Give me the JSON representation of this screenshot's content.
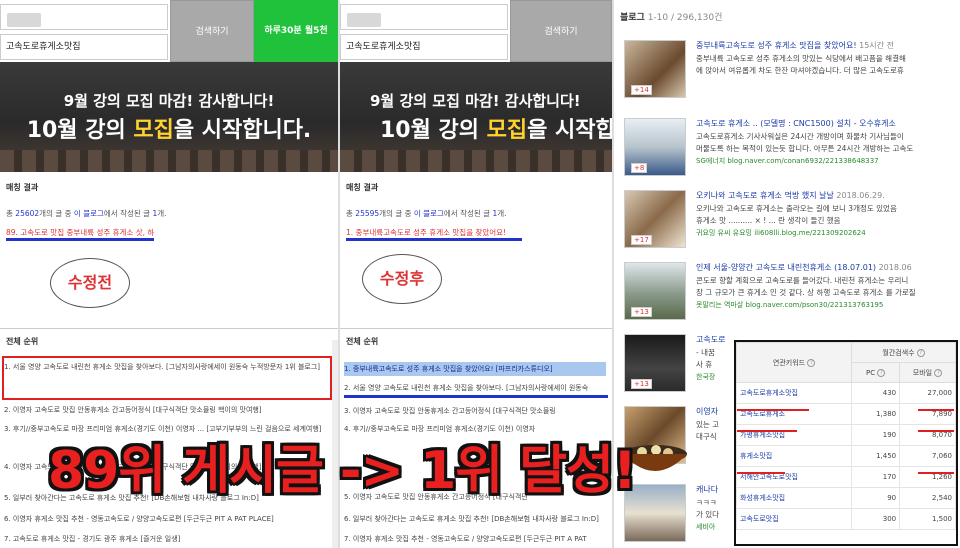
{
  "left": {
    "search_value": "고속도로휴게소맛집",
    "search_btn": "검색하기",
    "green_btn": "하루30분 월5천",
    "banner1": "9월 강의 모집 마감! 감사합니다!",
    "banner2_pre": "10월 강의 ",
    "banner2_y": "모집",
    "banner2_post": "을 시작합니다.",
    "section_match": "매칭 결과",
    "count_line_a": "총 ",
    "count_num": "25602",
    "count_line_b": "개의 글 중 ",
    "count_blog": "이 블로그",
    "count_line_c": "에서 작성된 글 ",
    "count_one": "1",
    "count_line_d": "개.",
    "match_line": "89. 고속도로 맛집 중부내륙 성주 휴게소 삿, 하",
    "bubble": "수정전",
    "section_rank": "전체 순위",
    "rows": [
      "1. 서울 영양 고속도로 내린천 휴게소 맛집을 찾아보다. [그남자의사랑에세이 원동숙 누적방문자 1위 블로그]",
      "2. 이영자 고속도로 맛집 안동휴게소 간고등어정식 [대구식객단 맛소믈링 핵이의 맛여행]",
      "3. 후기//중부고속도로 마장 프리미엄 휴게소(경기도 이천) 이영자 ... [고부기부부의 느린 걸음으로 세계여행]",
      "4. 이영자 고속도로 맛집 안동휴게소 간고등어정식 [대구식객단 맛소믈링 핵이의 맛여행]",
      "5. 일부러 찾아간다는 고속도로 휴게소 맛집 추천! [DB손해보험 내차사랑 블로그 In:D]",
      "6. 이영자 휴게소 맛집 추천 - 영동고속도로 / 양양고속도로편 [두근두근 PIT A PAT PLACE]",
      "7. 고속도로 휴게소 맛집 - 경기도 광주 휴게소 [즐거운 일생]"
    ]
  },
  "middle": {
    "search_value": "고속도로휴게소맛집",
    "search_btn": "검색하기",
    "banner1": "9월 강의 모집 마감! 감사합니다!",
    "banner2_pre": "10월 강의 ",
    "banner2_y": "모집",
    "banner2_post": "을 시작합니다.",
    "section_match": "매칭 결과",
    "count_line_a": "총 ",
    "count_num": "25595",
    "count_line_b": "개의 글 중 ",
    "count_blog": "이 블로그",
    "count_line_c": "에서 작성된 글 ",
    "count_one": "1",
    "count_line_d": "개.",
    "match_line": "1. 중부내륙고속도로 성주 휴게소 맛집을 찾았어요!",
    "bubble": "수정후",
    "section_rank": "전체 순위",
    "rows": [
      "1. 중부내륙고속도로 성주 휴게소 맛집을 찾았어요! [파프리카스튜디오]",
      "2. 서울 영양 고속도로 내린천 휴게소 맛집을 찾아보다. [그남자의사랑에세이 원동숙",
      "3. 이영자 고속도로 맛집 안동휴게소 간고등어정식 [대구식객단 맛소믈링",
      "4. 후기//중부고속도로 마장 프리미엄 휴게소(경기도 이천) 이영자",
      "5. 이영자 고속도로 맛집 안동휴게소 간고등어정식 [대구식객단",
      "6. 일부러 찾아간다는 고속도로 휴게소 맛집 추천! [DB손해보험 내차사랑 블로그 In:D]",
      "7. 이영자 휴게소 맛집 추천 - 영동고속도로 / 양양고속도로편 [두근두근 PIT A PAT"
    ]
  },
  "overlay_text": "89위 게시글 -> 1위 달성!",
  "right": {
    "header_title": "블로그",
    "header_range": " 1-10 / 296,130건",
    "items": [
      {
        "title": "중부내륙고속도로 성주 휴게소 맛집을 찾았어요!",
        "date": "15시간 전",
        "d1": "중부내륙 고속도로 성주 휴게소의 맛있는 식당에서 배고픔을 해결해",
        "d2": "에 앉아서 여유롭게 차도 한잔 마셔야겠습니다. 더 많은 고속도로휴",
        "url": "",
        "badge": "14"
      },
      {
        "title": "고속도로 휴게소 .. (모델명 : CNC1500) 설치 - 오수휴게소",
        "date": "",
        "d1": "고속도로휴게소 기사사워실은 24시간 개방이며 화물차 기사님들이",
        "d2": "머물도록 하는 목적이 있는듯 합니다. 아무튼 24시간 개방하는 고속도",
        "url": "SG에너지  blog.naver.com/conan6932/221338648337",
        "badge": "8"
      },
      {
        "title": "오키나와 고속도로 휴게소 먹방 했지 날날",
        "date": "2018.06.29.",
        "d1": "오키나와 고속도로 휴게소는 출라오는 길에 보니 3개정도 있었음",
        "d2": "휴게소 맛 .......... ×  ! ...  란 생각이 들긴 했음",
        "url": "귀요밍 유씨 유요밍  ili608lli.blog.me/221309202624",
        "badge": "17"
      },
      {
        "title": "인제 서울-양양간 고속도로 내린천휴게소 (18.07.01)",
        "date": "2018.06",
        "d1": "콘도로 향할 계획으로 고속도로를 들어갔다. 내린천 휴게소는 우리니",
        "d2": "장 그 규모가 큰 휴게소 인 것 같다. 상 하행 고속도로 휴게소 를 가로질",
        "url": "못말리는 역마살  blog.naver.com/pson30/221313763195",
        "badge": "13"
      },
      {
        "title": "고속도로",
        "date": "",
        "d1": "- 내꿈",
        "d2": "사 휴",
        "url": "한국장",
        "badge": "13"
      },
      {
        "title": "이영자",
        "date": "",
        "d1": "있는 고",
        "d2": "대구식",
        "url": "",
        "badge": "14"
      },
      {
        "title": "캐나다",
        "date": "",
        "d1": "ㅋㅋㅋ",
        "d2": "가 있다",
        "url": "세비아",
        "badge": ""
      }
    ]
  },
  "keyword_table": {
    "h_kw": "연관키워드",
    "h_month": "월간검색수",
    "h_pc": "PC",
    "h_mobile": "모바일",
    "rows": [
      {
        "kw": "고속도로휴게소맛집",
        "pc": "430",
        "mobile": "27,000"
      },
      {
        "kw": "고속도로휴게소",
        "pc": "1,380",
        "mobile": "7,890"
      },
      {
        "kw": "가평휴게소맛집",
        "pc": "190",
        "mobile": "8,070"
      },
      {
        "kw": "휴게소맛집",
        "pc": "1,450",
        "mobile": "7,060"
      },
      {
        "kw": "서해안고속도로맛집",
        "pc": "170",
        "mobile": "1,260"
      },
      {
        "kw": "화성휴게소맛집",
        "pc": "90",
        "mobile": "2,540"
      },
      {
        "kw": "고속도로맛집",
        "pc": "300",
        "mobile": "1,500"
      }
    ]
  }
}
